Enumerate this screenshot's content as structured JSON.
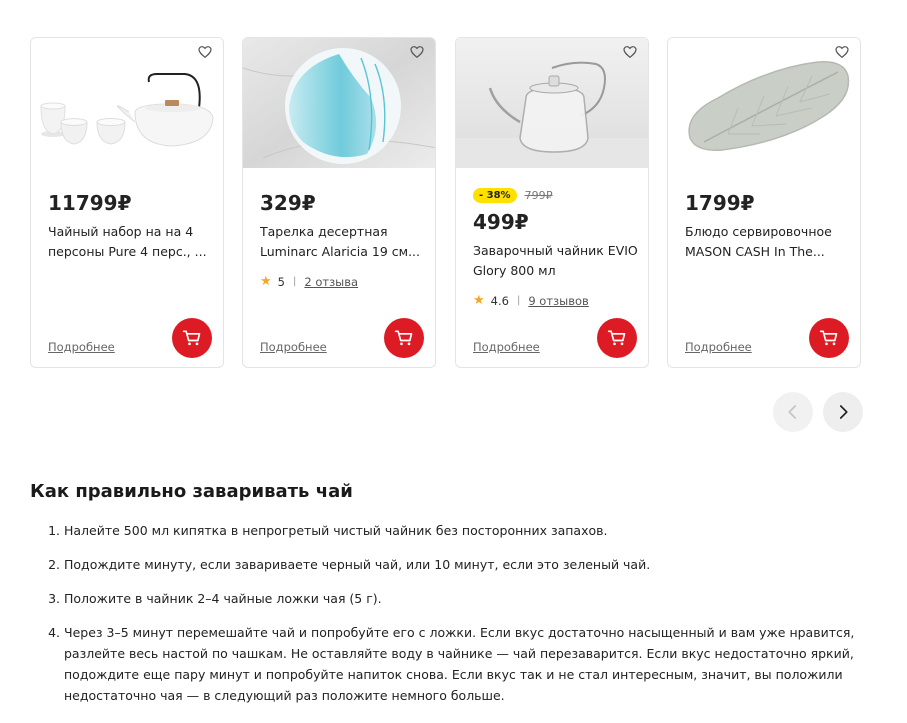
{
  "products": [
    {
      "price": "11799₽",
      "title": "Чайный набор на на 4 персоны Pure 4 перс., ...",
      "more": "Подробнее"
    },
    {
      "price": "329₽",
      "title": "Тарелка десертная Luminarc Alaricia 19 см...",
      "rating": "5",
      "reviews": "2 отзыва",
      "more": "Подробнее"
    },
    {
      "discount": "- 38%",
      "old_price": "799₽",
      "price": "499₽",
      "title": "Заварочный чайник EVIO Glory 800 мл",
      "rating": "4.6",
      "reviews": "9 отзывов",
      "more": "Подробнее"
    },
    {
      "price": "1799₽",
      "title": "Блюдо сервировочное MASON CASH In The...",
      "more": "Подробнее"
    }
  ],
  "icons": {
    "heart": "heart-outline-icon",
    "cart": "cart-icon",
    "star": "star-icon",
    "prev": "chevron-left-icon",
    "next": "chevron-right-icon"
  },
  "colors": {
    "cart_button": "#dd1b24",
    "discount_badge": "#ffe000",
    "star": "#f5a623"
  },
  "article": {
    "heading": "Как правильно заваривать чай",
    "steps": [
      "Налейте 500 мл кипятка в непрогретый чистый чайник без посторонних запахов.",
      "Подождите минуту, если завариваете черный чай, или 10 минут, если это зеленый чай.",
      "Положите в чайник 2–4 чайные ложки чая (5 г).",
      "Через 3–5 минут перемешайте чай и попробуйте его с ложки. Если вкус достаточно насыщенный и вам уже нравится, разлейте весь настой по чашкам. Не оставляйте воду в чайнике — чай перезаварится. Если вкус недостаточно яркий, подождите еще пару минут и попробуйте напиток снова. Если вкус так и не стал интересным, значит, вы положили недостаточно чая — в следующий раз положите немного больше."
    ]
  }
}
